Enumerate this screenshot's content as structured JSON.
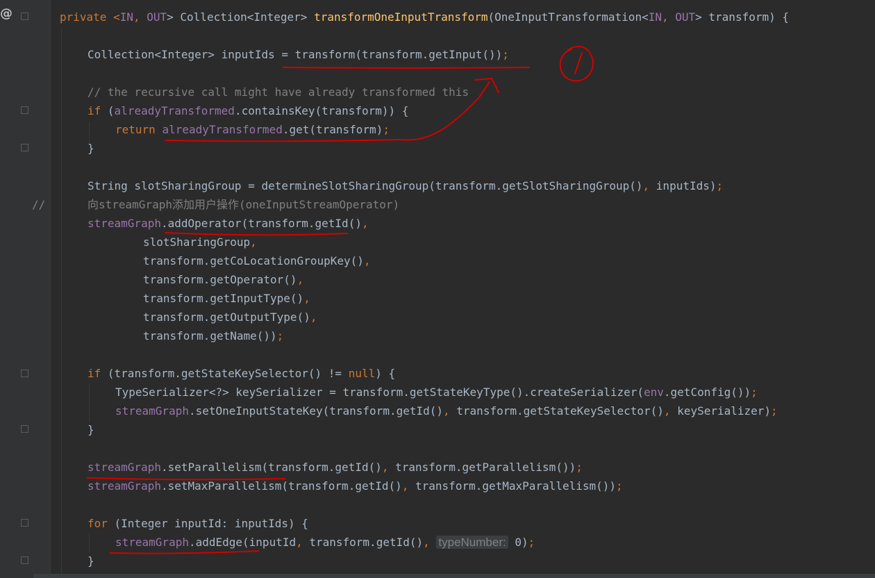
{
  "gutter": {
    "annotation_symbol": "@",
    "comment_marker": "//"
  },
  "code": {
    "line1": {
      "kw_private": "private ",
      "lt": "<",
      "t_in": "IN",
      "comma": ", ",
      "t_out": "OUT",
      "gt": "> Collection<Integer> ",
      "method": "transformOneInputTransform",
      "params_a": "(OneInputTransformation<",
      "p_in": "IN",
      "p_comma": ", ",
      "p_out": "OUT",
      "params_b": "> transform) {"
    },
    "line2": {
      "text": "Collection<Integer> inputIds = transform(transform.getInput())",
      "semi": ";"
    },
    "line3": {
      "text": "// the recursive call might have already transformed this"
    },
    "line4": {
      "kw": "if ",
      "a": "(",
      "field": "alreadyTransformed",
      "b": ".containsKey(transform)) {"
    },
    "line5": {
      "kw": "return ",
      "field": "alreadyTransformed",
      "b": ".get(transform)",
      "semi": ";"
    },
    "line6": {
      "text": "}"
    },
    "line7": {
      "text": "String slotSharingGroup = determineSlotSharingGroup(transform.getSlotSharingGroup()",
      "comma": ", ",
      "tail": "inputIds)",
      "semi": ";"
    },
    "line8": {
      "text": "向streamGraph添加用户操作(oneInputStreamOperator)"
    },
    "line9": {
      "field": "streamGraph",
      "b": ".addOperator(transform.getId()",
      "comma": ","
    },
    "line10": {
      "text": "slotSharingGroup",
      "comma": ","
    },
    "line11": {
      "text": "transform.getCoLocationGroupKey()",
      "comma": ","
    },
    "line12": {
      "text": "transform.getOperator()",
      "comma": ","
    },
    "line13": {
      "text": "transform.getInputType()",
      "comma": ","
    },
    "line14": {
      "text": "transform.getOutputType()",
      "comma": ","
    },
    "line15": {
      "text": "transform.getName())",
      "semi": ";"
    },
    "line16": {
      "kw": "if ",
      "a": "(transform.getStateKeySelector() != ",
      "null": "null",
      "b": ") {"
    },
    "line17": {
      "a": "TypeSerializer<?> keySerializer = transform.getStateKeyType().createSerializer(",
      "field": "env",
      "b": ".getConfig())",
      "semi": ";"
    },
    "line18": {
      "field": "streamGraph",
      "a": ".setOneInputStateKey(transform.getId()",
      "c1": ", ",
      "b": "transform.getStateKeySelector()",
      "c2": ", ",
      "c": "keySerializer)",
      "semi": ";"
    },
    "line19": {
      "text": "}"
    },
    "line20": {
      "field": "streamGraph",
      "a": ".setParallelism(transform.getId()",
      "c1": ", ",
      "b": "transform.getParallelism())",
      "semi": ";"
    },
    "line21": {
      "field": "streamGraph",
      "a": ".setMaxParallelism(transform.getId()",
      "c1": ", ",
      "b": "transform.getMaxParallelism())",
      "semi": ";"
    },
    "line22": {
      "kw": "for ",
      "a": "(Integer inputId: inputIds) {"
    },
    "line23": {
      "field": "streamGraph",
      "a": ".addEdge(inputId",
      "c1": ", ",
      "b": "transform.getId()",
      "c2": ", ",
      "hint": "typeNumber:",
      "c": " 0)",
      "semi": ";"
    },
    "line24": {
      "text": "}"
    }
  },
  "handwriting": {
    "circled_number": "1"
  },
  "colors": {
    "background": "#2b2b2b",
    "default_text": "#a9b7c6",
    "keyword": "#cc7832",
    "field": "#9876aa",
    "method_decl": "#ffc66d",
    "comment": "#808080",
    "ink_red": "#d40000"
  }
}
